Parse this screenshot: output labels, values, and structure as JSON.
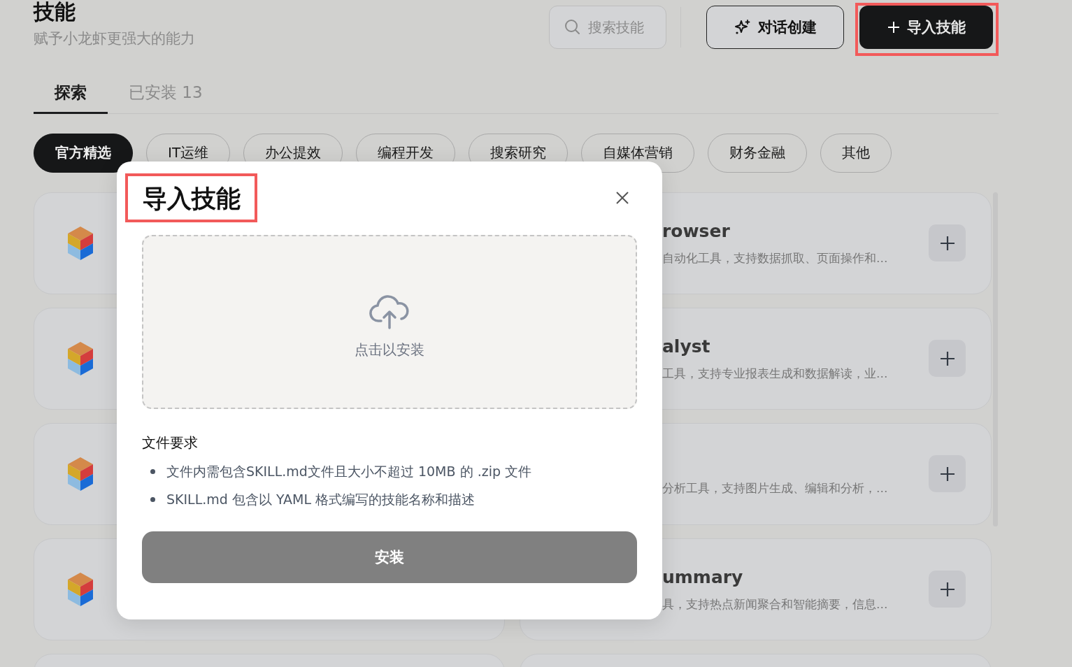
{
  "page": {
    "title": "技能",
    "subtitle": "赋予小龙虾更强大的能力"
  },
  "search": {
    "placeholder": "搜索技能"
  },
  "actions": [
    {
      "kind": "outline",
      "label": "对话创建",
      "highlighted": false
    },
    {
      "kind": "primary",
      "label": "导入技能",
      "highlighted": true
    }
  ],
  "tabs": [
    {
      "label": "探索",
      "selected": true
    },
    {
      "label": "已安装 13",
      "selected": false
    }
  ],
  "categories": [
    {
      "label": "官方精选",
      "selected": true
    },
    {
      "label": "IT运维",
      "selected": false
    },
    {
      "label": "办公提效",
      "selected": false
    },
    {
      "label": "编程开发",
      "selected": false
    },
    {
      "label": "搜索研究",
      "selected": false
    },
    {
      "label": "自媒体营销",
      "selected": false
    },
    {
      "label": "财务金融",
      "selected": false
    },
    {
      "label": "其他",
      "selected": false
    }
  ],
  "skill_cards": [
    {
      "kind": "covered"
    },
    {
      "kind": "listed",
      "name": "rowser",
      "description": "自动化工具，支持数据抓取、页面操作和…"
    },
    {
      "kind": "covered"
    },
    {
      "kind": "listed",
      "name": "alyst",
      "description": "工具，支持专业报表生成和数据解读，业…"
    },
    {
      "kind": "covered"
    },
    {
      "kind": "listed",
      "description": "分析工具，支持图片生成、编辑和分析，…"
    },
    {
      "kind": "covered"
    },
    {
      "kind": "listed",
      "name": "ummary",
      "description": "具，支持热点新闻聚合和智能摘要，信息…"
    },
    {
      "kind": "edge"
    },
    {
      "kind": "edge"
    }
  ],
  "import_dialog": {
    "title": "导入技能",
    "title_highlighted": true,
    "dropzone": {
      "label": "点击以安装"
    },
    "requirements_title": "文件要求",
    "requirements": [
      "文件内需包含SKILL.md文件且大小不超过 10MB 的 .zip 文件",
      "SKILL.md 包含以 YAML 格式编写的技能名称和描述"
    ],
    "install_button": {
      "label": "安装",
      "disabled": true
    }
  }
}
